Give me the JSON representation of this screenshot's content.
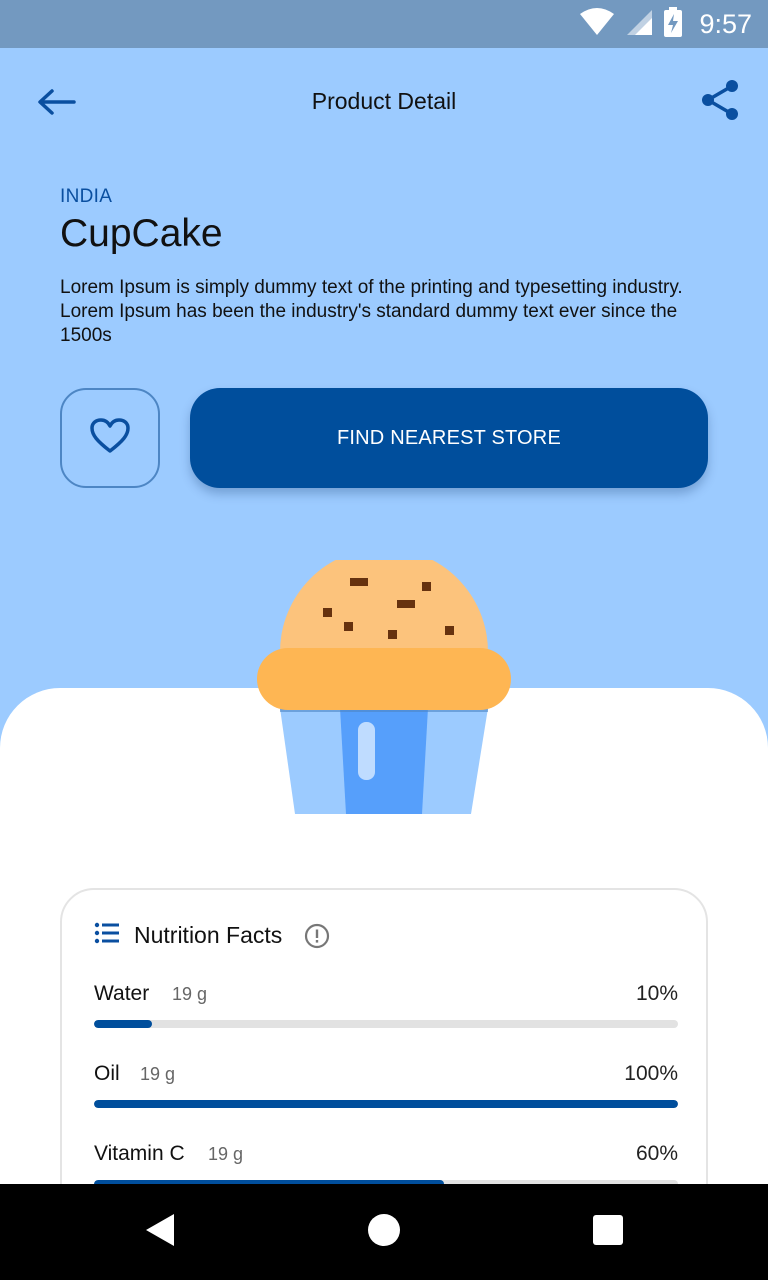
{
  "status_bar": {
    "time": "9:57"
  },
  "app_bar": {
    "title": "Product Detail"
  },
  "product": {
    "origin": "INDIA",
    "name": "CupCake",
    "description": "Lorem Ipsum is simply dummy text of the printing and typesetting industry. Lorem Ipsum has been the industry's standard dummy text ever since the 1500s"
  },
  "actions": {
    "find_store_label": "FIND NEAREST STORE"
  },
  "nutrition": {
    "title": "Nutrition Facts",
    "items": [
      {
        "name": "Water",
        "amount": "19 g",
        "percent_label": "10%",
        "percent": 10
      },
      {
        "name": "Oil",
        "amount": "19 g",
        "percent_label": "100%",
        "percent": 100
      },
      {
        "name": "Vitamin C",
        "amount": "19 g",
        "percent_label": "60%",
        "percent": 60
      }
    ]
  },
  "colors": {
    "background": "#9ccbff",
    "status_bar": "#7399c0",
    "primary": "#004e9c",
    "accent_text": "#0a4fa0",
    "progress_track": "#e2e2e2",
    "cupcake_top": "#fcc37c",
    "cupcake_rim": "#feb653",
    "cupcake_liner": "#9ccbff",
    "cupcake_liner_center": "#569ffb",
    "sprinkles": "#66320f"
  },
  "icons": {
    "back": "arrow-left-icon",
    "share": "share-icon",
    "favorite": "heart-outline-icon",
    "nutrition": "list-icon",
    "info": "info-circle-icon",
    "wifi": "wifi-icon",
    "signal": "signal-icon",
    "battery": "battery-charging-icon",
    "nav_back": "triangle-back-icon",
    "nav_home": "circle-home-icon",
    "nav_recents": "square-recents-icon"
  }
}
